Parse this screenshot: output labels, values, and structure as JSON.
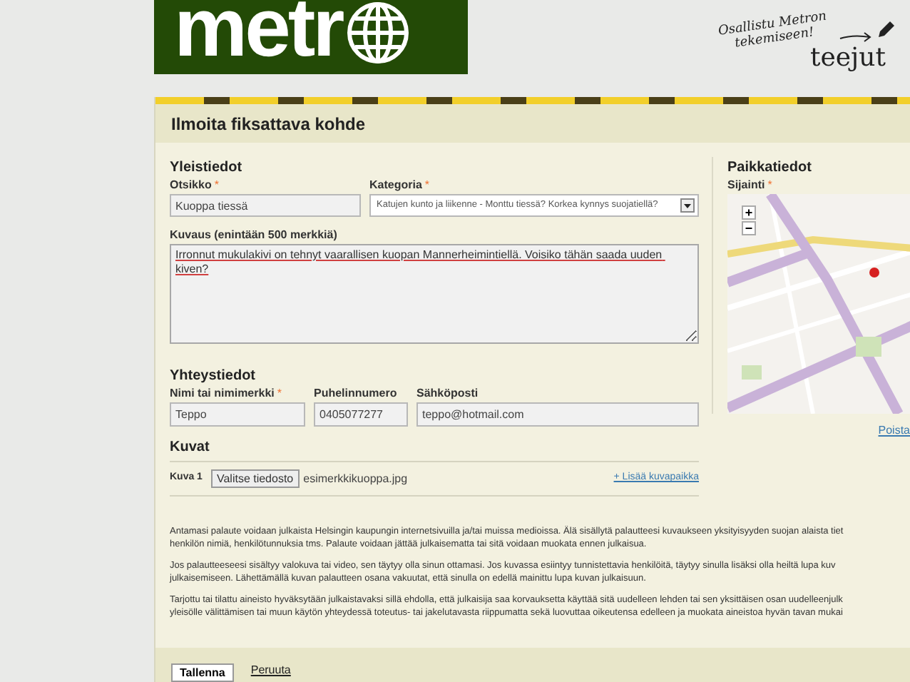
{
  "header": {
    "logo": "metr",
    "promo_line_1": "Osallistu Metron",
    "promo_line_2": "tekemiseen!",
    "promo_brand": "teejut"
  },
  "form": {
    "title": "Ilmoita fiksattava kohde",
    "general": {
      "heading": "Yleistiedot",
      "fields": [
        {
          "label": "Otsikko",
          "required_mark": "*",
          "kind": "input",
          "value": "Kuoppa tiessä"
        },
        {
          "label": "Kategoria",
          "required_mark": "*",
          "kind": "select",
          "value": "Katujen kunto ja liikenne - Monttu tiessä? Korkea kynnys suojatiellä?"
        }
      ],
      "description": {
        "label": "Kuvaus (enintään 500 merkkiä)",
        "value": "Irronnut mukulakivi on tehnyt vaarallisen kuopan Mannerheimintiellä. Voisiko tähän saada uuden kiven?"
      }
    },
    "location": {
      "heading": "Paikkatiedot",
      "label": "Sijainti",
      "required_mark": "*",
      "zoom_in": "+",
      "zoom_out": "−",
      "remove_link": "Poista"
    },
    "contact": {
      "heading": "Yhteystiedot",
      "fields": [
        {
          "label": "Nimi tai nimimerkki",
          "required_mark": "*",
          "value": "Teppo"
        },
        {
          "label": "Puhelinnumero",
          "value": "0405077277"
        },
        {
          "label": "Sähköposti",
          "value": "teppo@hotmail.com"
        }
      ]
    },
    "images": {
      "heading": "Kuvat",
      "rows": [
        {
          "label": "Kuva 1",
          "button": "Valitse tiedosto",
          "file": "esimerkkikuoppa.jpg"
        }
      ],
      "add_link": "+ Lisää kuvapaikka"
    },
    "terms": [
      [
        "Antamasi palaute voidaan julkaista Helsingin kaupungin internetsivuilla ja/tai muissa medioissa. Älä sisällytä palautteesi kuvaukseen yksityisyyden suojan alaista tiet",
        "henkilön nimiä, henkilötunnuksia tms. Palaute voidaan jättää julkaisematta tai sitä voidaan muokata ennen julkaisua."
      ],
      [
        "Jos palautteeseesi sisältyy valokuva tai video, sen täytyy olla sinun ottamasi. Jos kuvassa esiintyy tunnistettavia henkilöitä, täytyy sinulla lisäksi olla heiltä lupa kuv",
        "julkaisemiseen. Lähettämällä kuvan palautteen osana vakuutat, että sinulla on edellä mainittu lupa kuvan julkaisuun."
      ],
      [
        "Tarjottu tai tilattu aineisto hyväksytään julkaistavaksi sillä ehdolla, että julkaisija saa korvauksetta käyttää sitä uudelleen lehden tai sen yksittäisen osan uudelleenjulk",
        "yleisölle välittämisen tai muun käytön yhteydessä toteutus- tai jakelutavasta riippumatta sekä luovuttaa oikeutensa edelleen ja muokata aineistoa hyvän tavan mukai"
      ]
    ],
    "save_button": "Tallenna",
    "cancel_link": "Peruuta"
  }
}
